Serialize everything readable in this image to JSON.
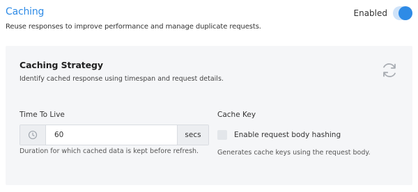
{
  "header": {
    "title": "Caching",
    "description": "Reuse responses to improve performance and manage duplicate requests.",
    "toggle_label": "Enabled",
    "toggle_on": true
  },
  "strategy": {
    "title": "Caching Strategy",
    "description": "Identify cached response using timespan and request details.",
    "refresh_icon": "refresh-icon"
  },
  "ttl": {
    "label": "Time To Live",
    "value": "60",
    "unit": "secs",
    "prefix_icon": "clock-icon",
    "help": "Duration for which cached data is kept before refresh."
  },
  "cache_key": {
    "label": "Cache Key",
    "checkbox_label": "Enable request body hashing",
    "checked": false,
    "help": "Generates cache keys using the request body."
  },
  "colors": {
    "accent": "#2e8be6",
    "panel_bg": "#f5f6f8"
  }
}
